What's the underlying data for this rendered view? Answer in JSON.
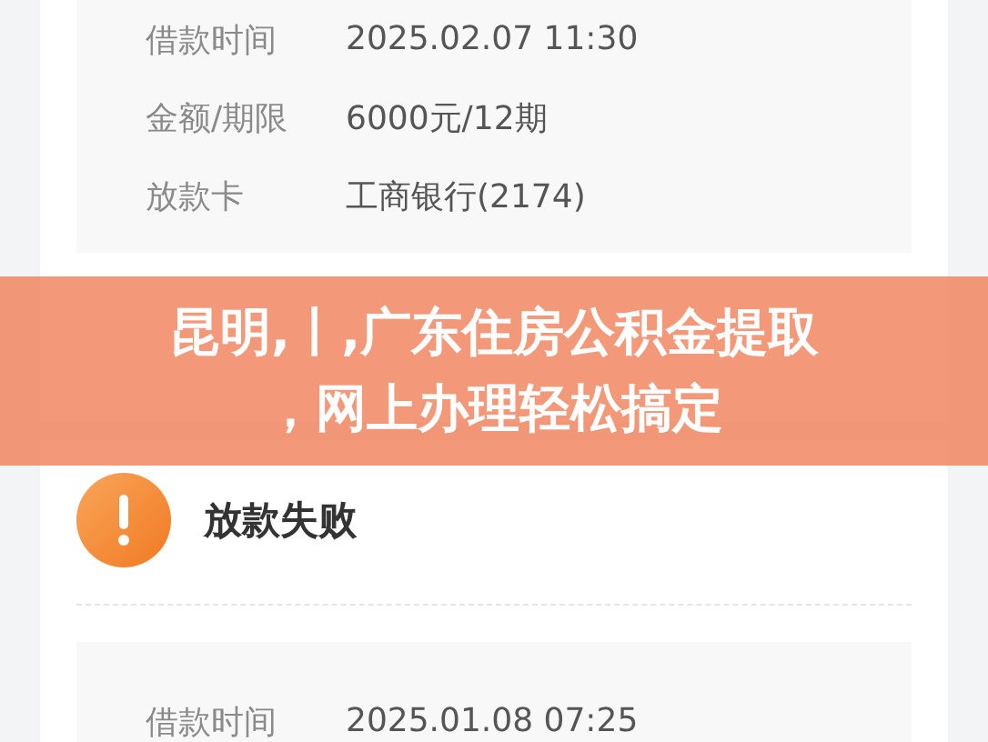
{
  "loan_records": [
    {
      "fields": [
        {
          "label": "借款时间",
          "value": "2025.02.07 11:30"
        },
        {
          "label": "金额/期限",
          "value": "6000元/12期"
        },
        {
          "label": "放款卡",
          "value": "工商银行(2174)"
        }
      ]
    },
    {
      "status": {
        "kind": "warning",
        "text": "放款失败"
      },
      "fields": [
        {
          "label": "借款时间",
          "value": "2025.01.08 07:25"
        }
      ]
    }
  ],
  "banner": {
    "title_lines": [
      "昆明,丨,广东住房公积金提取",
      "，网上办理轻松搞定"
    ]
  }
}
